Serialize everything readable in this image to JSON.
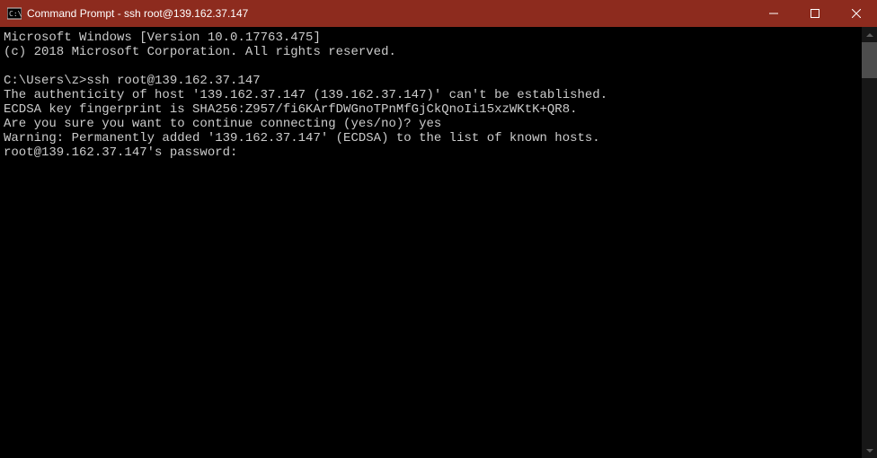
{
  "titlebar": {
    "title": "Command Prompt - ssh  root@139.162.37.147"
  },
  "terminal": {
    "lines": [
      "Microsoft Windows [Version 10.0.17763.475]",
      "(c) 2018 Microsoft Corporation. All rights reserved.",
      "",
      "C:\\Users\\z>ssh root@139.162.37.147",
      "The authenticity of host '139.162.37.147 (139.162.37.147)' can't be established.",
      "ECDSA key fingerprint is SHA256:Z957/fi6KArfDWGnoTPnMfGjCkQnoIi15xzWKtK+QR8.",
      "Are you sure you want to continue connecting (yes/no)? yes",
      "Warning: Permanently added '139.162.37.147' (ECDSA) to the list of known hosts.",
      "root@139.162.37.147's password:"
    ]
  }
}
